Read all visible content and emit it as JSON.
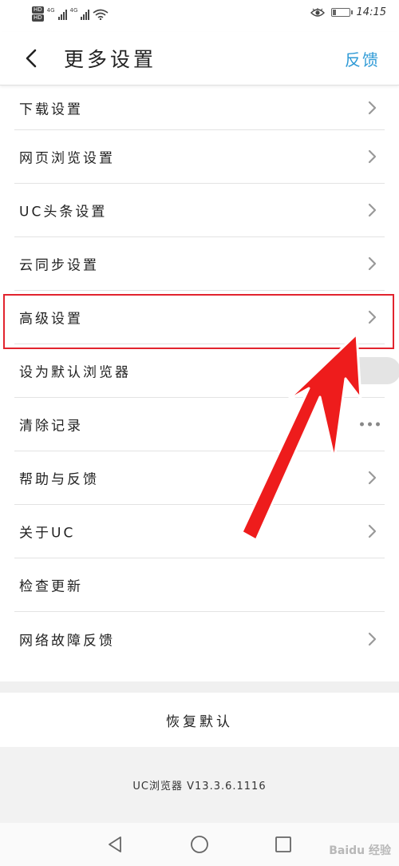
{
  "status_bar": {
    "sim1_badge": "HD",
    "sim2_badge": "HD",
    "sim1_network": "4G",
    "sim2_network": "4G",
    "battery_level": 0.2,
    "time": "14:15"
  },
  "header": {
    "title": "更多设置",
    "feedback_label": "反馈"
  },
  "settings": [
    {
      "label": "下载设置",
      "control": "chevron"
    },
    {
      "label": "网页浏览设置",
      "control": "chevron"
    },
    {
      "label": "UC头条设置",
      "control": "chevron"
    },
    {
      "label": "云同步设置",
      "control": "chevron"
    },
    {
      "label": "高级设置",
      "control": "chevron"
    },
    {
      "label": "设为默认浏览器",
      "control": "toggle",
      "toggle_on": false
    },
    {
      "label": "清除记录",
      "control": "more"
    },
    {
      "label": "帮助与反馈",
      "control": "chevron"
    },
    {
      "label": "关于UC",
      "control": "chevron"
    },
    {
      "label": "检查更新",
      "control": "none"
    },
    {
      "label": "网络故障反馈",
      "control": "chevron"
    }
  ],
  "restore_label": "恢复默认",
  "version_text": "UC浏览器 V13.3.6.1116",
  "watermark": "Baidu 经验",
  "colors": {
    "accent": "#2e9ad6",
    "highlight": "#e2242e",
    "divider": "#e3e3e3"
  }
}
